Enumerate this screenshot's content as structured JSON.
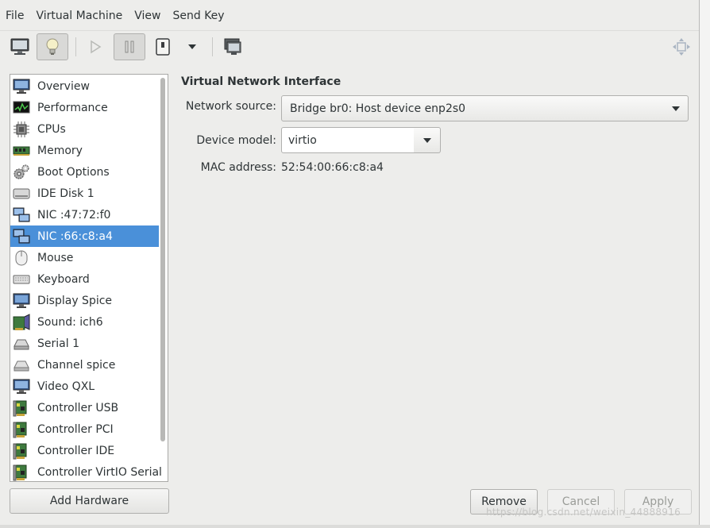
{
  "menu": [
    "File",
    "Virtual Machine",
    "View",
    "Send Key"
  ],
  "toolbar": {
    "buttons": [
      "console-monitor-icon",
      "details-lightbulb-icon",
      "run-play-icon",
      "pause-icon",
      "shutdown-power-icon",
      "shutdown-dropdown-icon",
      "snapshots-icon",
      "fullscreen-move-icon"
    ]
  },
  "hardware": {
    "items": [
      {
        "label": "Overview",
        "icon": "monitor-icon"
      },
      {
        "label": "Performance",
        "icon": "performance-graph-icon"
      },
      {
        "label": "CPUs",
        "icon": "cpu-chip-icon"
      },
      {
        "label": "Memory",
        "icon": "memory-ram-icon"
      },
      {
        "label": "Boot Options",
        "icon": "gears-icon"
      },
      {
        "label": "IDE Disk 1",
        "icon": "disk-drive-icon"
      },
      {
        "label": "NIC :47:72:f0",
        "icon": "network-icon"
      },
      {
        "label": "NIC :66:c8:a4",
        "icon": "network-icon"
      },
      {
        "label": "Mouse",
        "icon": "mouse-icon"
      },
      {
        "label": "Keyboard",
        "icon": "keyboard-icon"
      },
      {
        "label": "Display Spice",
        "icon": "display-monitor-icon"
      },
      {
        "label": "Sound: ich6",
        "icon": "sound-card-icon"
      },
      {
        "label": "Serial 1",
        "icon": "serial-port-icon"
      },
      {
        "label": "Channel spice",
        "icon": "channel-icon"
      },
      {
        "label": "Video QXL",
        "icon": "video-monitor-icon"
      },
      {
        "label": "Controller USB",
        "icon": "controller-card-icon"
      },
      {
        "label": "Controller PCI",
        "icon": "controller-card-icon"
      },
      {
        "label": "Controller IDE",
        "icon": "controller-card-icon"
      },
      {
        "label": "Controller VirtIO Serial",
        "icon": "controller-card-icon"
      }
    ],
    "selected": "NIC :66:c8:a4",
    "add_label": "Add Hardware"
  },
  "detail": {
    "title": "Virtual Network Interface",
    "network_source_label": "Network source:",
    "network_source_value": "Bridge br0: Host device enp2s0",
    "device_model_label": "Device model:",
    "device_model_value": "virtio",
    "mac_label": "MAC address:",
    "mac_value": "52:54:00:66:c8:a4"
  },
  "actions": {
    "remove": "Remove",
    "cancel": "Cancel",
    "apply": "Apply"
  },
  "watermark": "https://blog.csdn.net/weixin_44888916",
  "colors": {
    "selection": "#4a90d9",
    "window_bg": "#ededeb"
  }
}
